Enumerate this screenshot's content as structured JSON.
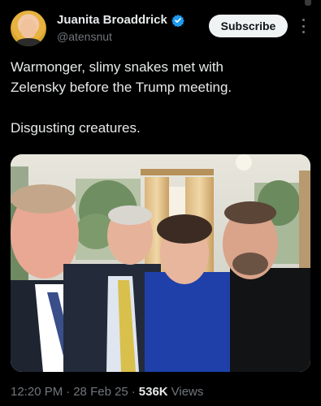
{
  "post": {
    "author": {
      "display_name": "Juanita Broaddrick",
      "handle": "@atensnut",
      "verified": true,
      "verified_color": "#1d9bf0"
    },
    "subscribe_label": "Subscribe",
    "text_line1": "Warmonger, slimy snakes met with",
    "text_line2": "Zelensky before  the Trump meeting.",
    "text_line3": "Disgusting creatures.",
    "time": "12:20 PM",
    "separator": "·",
    "date": "28 Feb 25",
    "views_count": "536K",
    "views_label": "Views"
  },
  "colors": {
    "background": "#000000",
    "text_primary": "#e7e9ea",
    "text_secondary": "#71767b",
    "subscribe_bg": "#eff3f4"
  },
  "icons": [
    "verified-icon",
    "more-icon"
  ]
}
